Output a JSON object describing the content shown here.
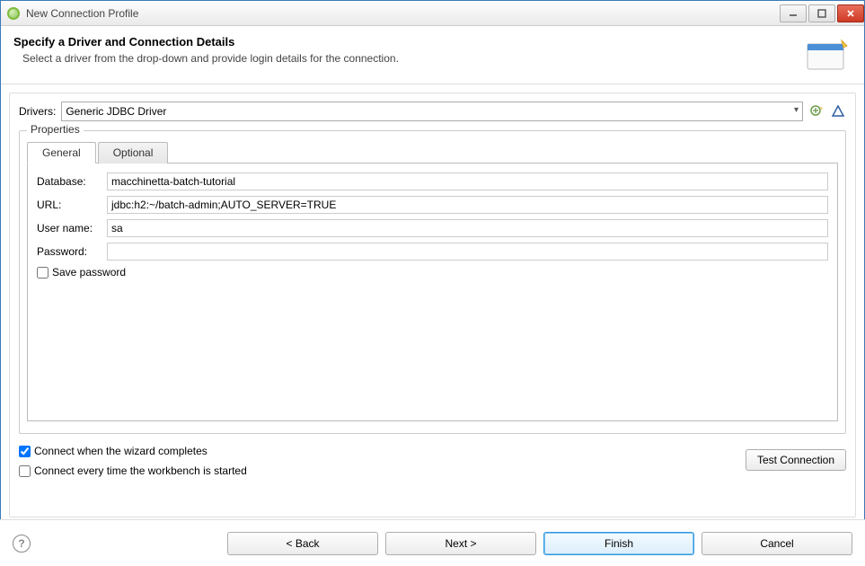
{
  "window": {
    "title": "New Connection Profile"
  },
  "header": {
    "title": "Specify a Driver and Connection Details",
    "description": "Select a driver from the drop-down and provide login details for the connection."
  },
  "drivers": {
    "label": "Drivers:",
    "selected": "Generic JDBC Driver"
  },
  "properties": {
    "legend": "Properties",
    "tabs": {
      "general": "General",
      "optional": "Optional"
    },
    "general": {
      "database_label": "Database:",
      "database_value": "macchinetta-batch-tutorial",
      "url_label": "URL:",
      "url_value": "jdbc:h2:~/batch-admin;AUTO_SERVER=TRUE",
      "username_label": "User name:",
      "username_value": "sa",
      "password_label": "Password:",
      "password_value": "",
      "save_password_label": "Save password",
      "save_password_checked": false
    }
  },
  "options": {
    "connect_on_complete_label": "Connect when the wizard completes",
    "connect_on_complete_checked": true,
    "connect_every_start_label": "Connect every time the workbench is started",
    "connect_every_start_checked": false,
    "test_connection_label": "Test Connection"
  },
  "footer": {
    "back": "< Back",
    "next": "Next >",
    "finish": "Finish",
    "cancel": "Cancel"
  }
}
